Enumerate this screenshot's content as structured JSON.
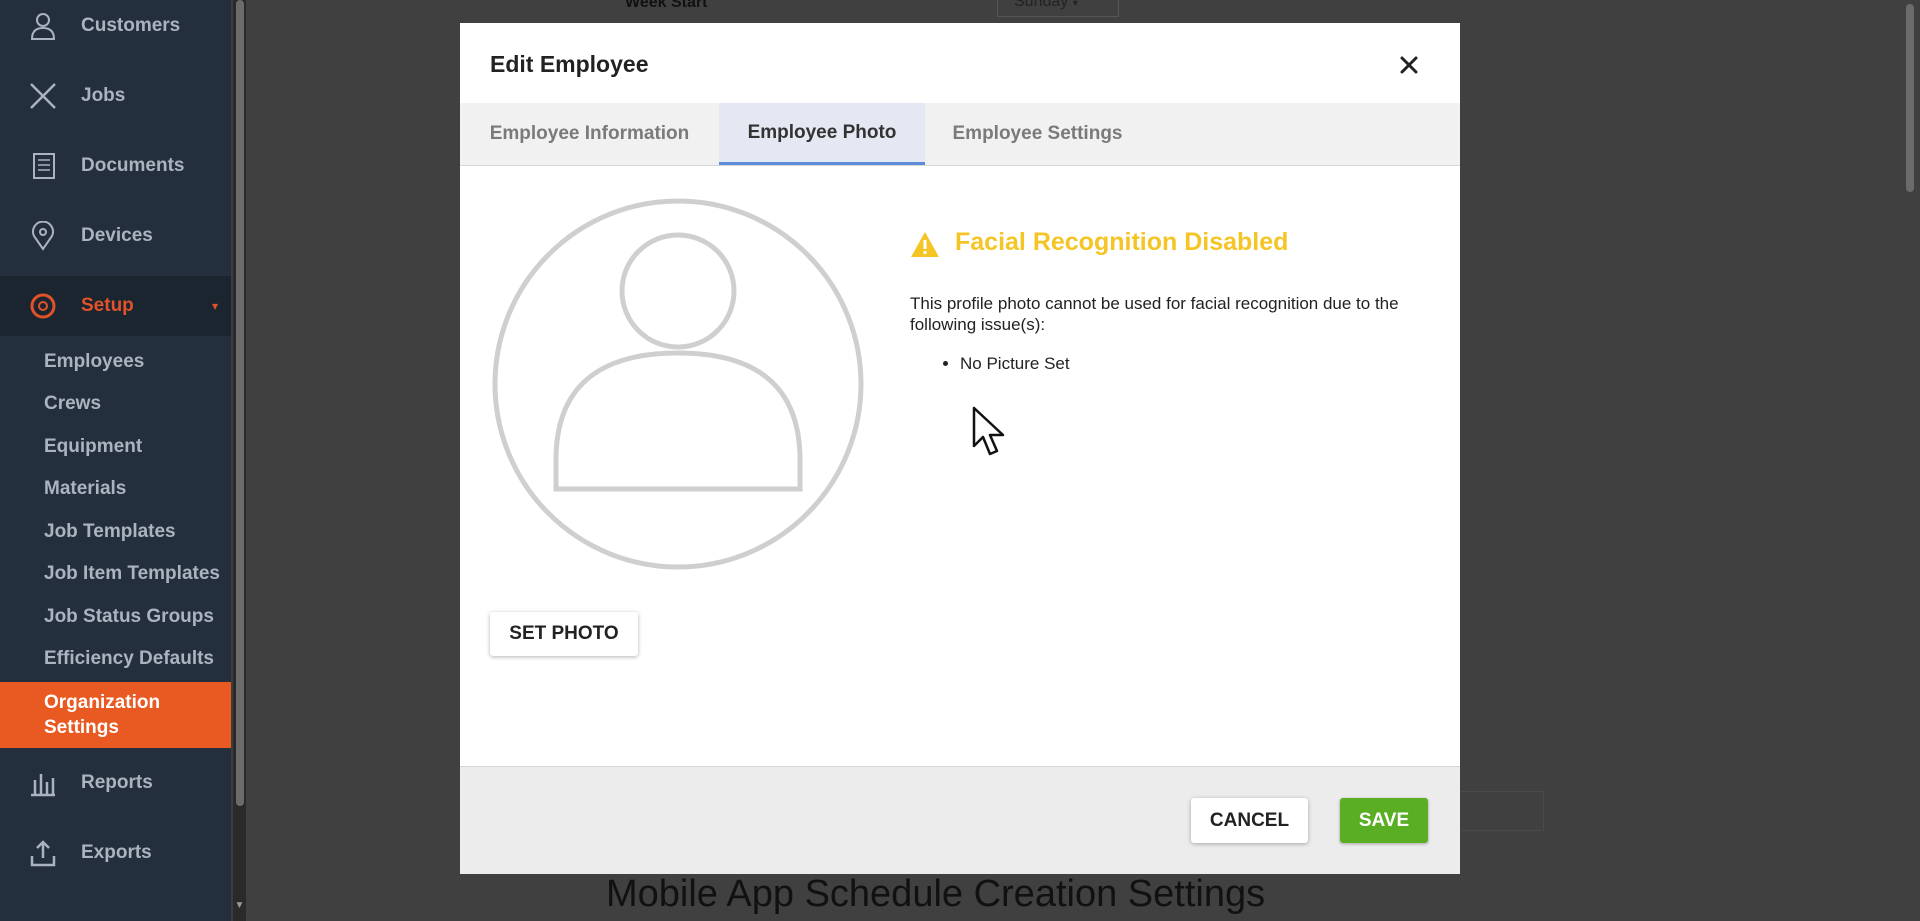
{
  "sidebar": {
    "nav": [
      {
        "label": "Customers",
        "icon": "user-icon"
      },
      {
        "label": "Jobs",
        "icon": "tools-icon"
      },
      {
        "label": "Documents",
        "icon": "documents-icon"
      },
      {
        "label": "Devices",
        "icon": "location-pin-icon"
      },
      {
        "label": "Setup",
        "icon": "gear-icon"
      }
    ],
    "setup_items": [
      {
        "label": "Employees"
      },
      {
        "label": "Crews"
      },
      {
        "label": "Equipment"
      },
      {
        "label": "Materials"
      },
      {
        "label": "Job Templates"
      },
      {
        "label": "Job Item Templates"
      },
      {
        "label": "Job Status Groups"
      },
      {
        "label": "Efficiency Defaults"
      },
      {
        "label": "Organization Settings"
      }
    ],
    "bottom_nav": [
      {
        "label": "Reports",
        "icon": "bar-chart-icon"
      },
      {
        "label": "Exports",
        "icon": "upload-icon"
      }
    ]
  },
  "background": {
    "week_start_label": "Week Start",
    "week_start_value": "Sunday",
    "section_heading": "Mobile App Schedule Creation Settings"
  },
  "modal": {
    "title": "Edit Employee",
    "tabs": [
      {
        "label": "Employee Information"
      },
      {
        "label": "Employee Photo",
        "active": true
      },
      {
        "label": "Employee Settings"
      }
    ],
    "warning": {
      "title": "Facial Recognition Disabled",
      "text": "This profile photo cannot be used for facial recognition due to the following issue(s):",
      "issues": [
        "No Picture Set"
      ],
      "color": "#f4c524"
    },
    "set_photo_label": "SET PHOTO",
    "cancel_label": "CANCEL",
    "save_label": "SAVE",
    "save_color": "#5aae23"
  }
}
